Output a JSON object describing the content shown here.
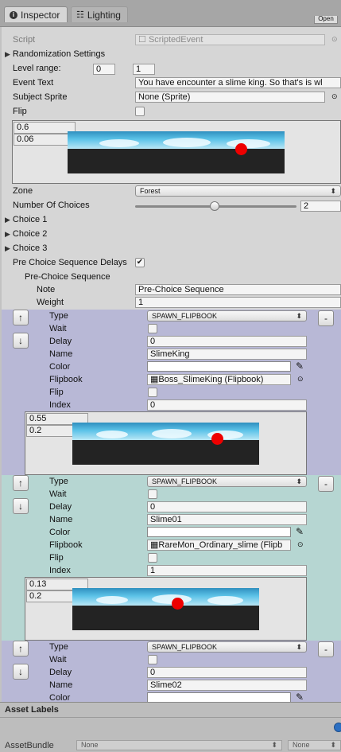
{
  "tabs": {
    "inspector": "Inspector",
    "lighting": "Lighting",
    "open_button": "Open"
  },
  "script": {
    "label": "Script",
    "value": "ScriptedEvent"
  },
  "randomization": {
    "label": "Randomization Settings"
  },
  "level_range": {
    "label": "Level range:",
    "min": "0",
    "max": "1"
  },
  "event_text": {
    "label": "Event Text",
    "value": "You  have encounter a slime king. So that's is wl"
  },
  "subject_sprite": {
    "label": "Subject Sprite",
    "value": "None (Sprite)"
  },
  "flip": {
    "label": "Flip"
  },
  "main_preview": {
    "v1": "0.6",
    "v2": "0.06"
  },
  "zone": {
    "label": "Zone",
    "value": "Forest"
  },
  "choices": {
    "label": "Number Of Choices",
    "value": "2",
    "slider_fraction": 0.55,
    "items": [
      "Choice 1",
      "Choice 2",
      "Choice 3"
    ]
  },
  "pre_choice": {
    "delays_label": "Pre Choice Sequence Delays",
    "sequence_label": "Pre-Choice Sequence",
    "note_label": "Note",
    "note_value": "Pre-Choice Sequence",
    "weight_label": "Weight",
    "weight_value": "1"
  },
  "step_labels": {
    "type": "Type",
    "wait": "Wait",
    "delay": "Delay",
    "name": "Name",
    "color": "Color",
    "flipbook": "Flipbook",
    "flip": "Flip",
    "index": "Index"
  },
  "steps": [
    {
      "type": "SPAWN_FLIPBOOK",
      "delay": "0",
      "name": "SlimeKing",
      "flipbook": "Boss_SlimeKing (Flipbook)",
      "index": "0",
      "pv1": "0.55",
      "pv2": "0.2"
    },
    {
      "type": "SPAWN_FLIPBOOK",
      "delay": "0",
      "name": "Slime01",
      "flipbook": "RareMon_Ordinary_slime (Flipb",
      "index": "1",
      "pv1": "0.13",
      "pv2": "0.2"
    },
    {
      "type": "SPAWN_FLIPBOOK",
      "delay": "0",
      "name": "Slime02"
    }
  ],
  "buttons": {
    "up": "↑",
    "down": "↓",
    "remove": "-"
  },
  "asset_labels": {
    "title": "Asset Labels",
    "bundle_label": "AssetBundle",
    "bundle_value": "None",
    "variant_value": "None"
  },
  "colors": {
    "step_purple": "#b8b8d6",
    "step_teal": "#b6d6d2",
    "panel": "#d6d6d6"
  },
  "icons": [
    "info-icon",
    "lighting-icon",
    "target-icon",
    "eyedropper-icon",
    "dropdown-icon"
  ]
}
